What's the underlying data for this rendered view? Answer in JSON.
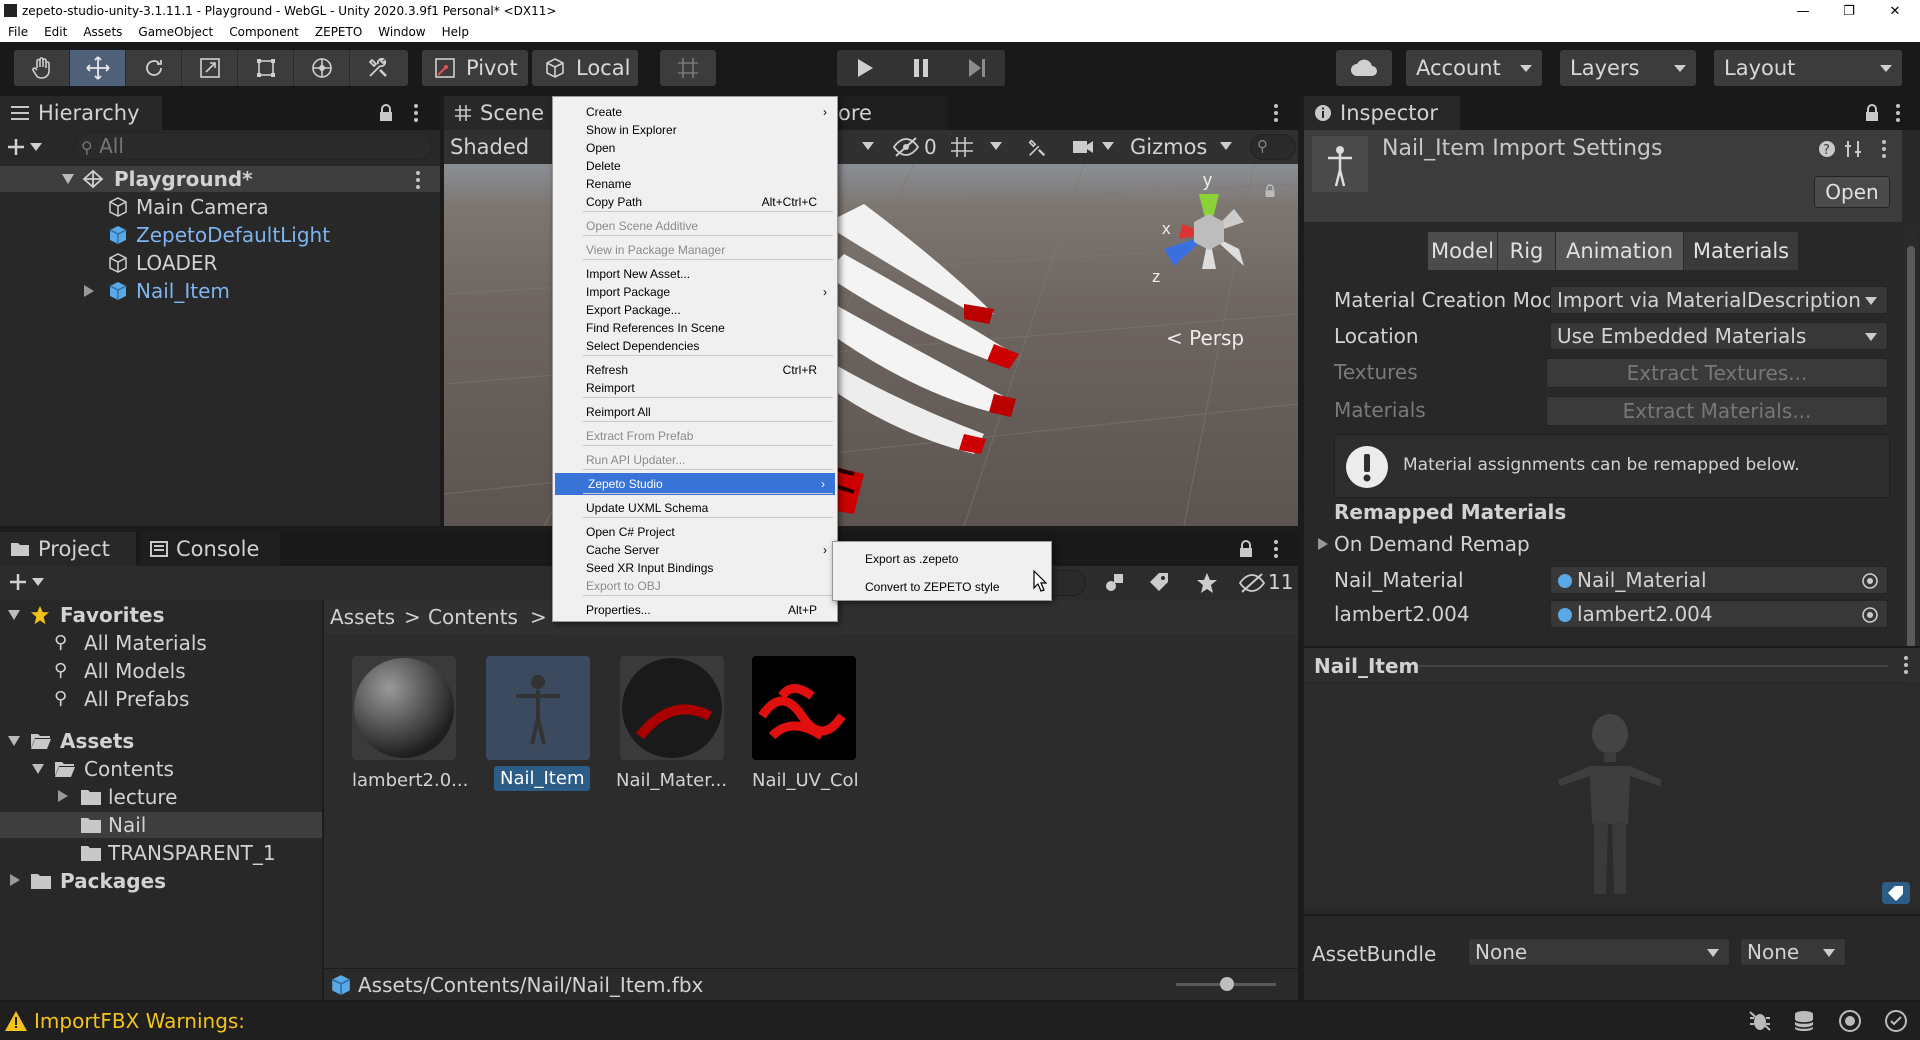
{
  "window": {
    "title": "zepeto-studio-unity-3.1.11.1 - Playground - WebGL - Unity 2020.3.9f1 Personal* <DX11>",
    "controls": [
      "—",
      "❐",
      "✕"
    ]
  },
  "menubar": [
    "File",
    "Edit",
    "Assets",
    "GameObject",
    "Component",
    "ZEPETO",
    "Window",
    "Help"
  ],
  "toolbar": {
    "pivot": "Pivot",
    "local": "Local",
    "account": "Account",
    "layers": "Layers",
    "layout": "Layout"
  },
  "hierarchy": {
    "tab": "Hierarchy",
    "search_placeholder": "All",
    "scene": "Playground*",
    "items": [
      "Main Camera",
      "ZepetoDefaultLight",
      "LOADER",
      "Nail_Item"
    ]
  },
  "scene": {
    "tab": "Scene",
    "tab2_partial": "ore",
    "shading": "Shaded",
    "hidden_count": "0",
    "gizmos": "Gizmos",
    "persp": "< Persp",
    "axes": {
      "y": "y",
      "x": "x",
      "z": "z"
    }
  },
  "context_menu": [
    {
      "label": "Create",
      "sub": true
    },
    {
      "label": "Show in Explorer"
    },
    {
      "label": "Open"
    },
    {
      "label": "Delete"
    },
    {
      "label": "Rename"
    },
    {
      "label": "Copy Path",
      "shortcut": "Alt+Ctrl+C"
    },
    {
      "label": "Open Scene Additive",
      "disabled": true
    },
    {
      "label": "View in Package Manager",
      "disabled": true
    },
    {
      "label": "Import New Asset..."
    },
    {
      "label": "Import Package",
      "sub": true
    },
    {
      "label": "Export Package..."
    },
    {
      "label": "Find References In Scene"
    },
    {
      "label": "Select Dependencies"
    },
    {
      "label": "Refresh",
      "shortcut": "Ctrl+R"
    },
    {
      "label": "Reimport"
    },
    {
      "label": "Reimport All"
    },
    {
      "label": "Extract From Prefab",
      "disabled": true
    },
    {
      "label": "Run API Updater...",
      "disabled": true
    },
    {
      "label": "Zepeto Studio",
      "sub": true,
      "highlighted": true
    },
    {
      "label": "Update UXML Schema"
    },
    {
      "label": "Open C# Project"
    },
    {
      "label": "Cache Server",
      "sub": true
    },
    {
      "label": "Seed XR Input Bindings"
    },
    {
      "label": "Export to OBJ",
      "disabled": true
    },
    {
      "label": "Properties...",
      "shortcut": "Alt+P"
    }
  ],
  "submenu": [
    "Export as .zepeto",
    "Convert to ZEPETO style"
  ],
  "project": {
    "tab": "Project",
    "tab_console": "Console",
    "hidden_count": "11",
    "favorites": "Favorites",
    "fav_items": [
      "All Materials",
      "All Models",
      "All Prefabs"
    ],
    "assets": "Assets",
    "contents": "Contents",
    "folders": [
      "lecture",
      "Nail",
      "TRANSPARENT_1"
    ],
    "packages": "Packages",
    "breadcrumb": [
      "Assets",
      ">",
      "Contents",
      ">"
    ],
    "files": [
      "lambert2.0...",
      "Nail_Item",
      "Nail_Mater...",
      "Nail_UV_Col"
    ],
    "path": "Assets/Contents/Nail/Nail_Item.fbx"
  },
  "inspector": {
    "tab": "Inspector",
    "title": "Nail_Item Import Settings",
    "open": "Open",
    "tabs": [
      "Model",
      "Rig",
      "Animation",
      "Materials"
    ],
    "material_creation_label": "Material Creation Moc",
    "material_creation_value": "Import via MaterialDescription",
    "location_label": "Location",
    "location_value": "Use Embedded Materials",
    "textures_label": "Textures",
    "extract_textures": "Extract Textures...",
    "materials_label": "Materials",
    "extract_materials": "Extract Materials...",
    "info": "Material assignments can be remapped below.",
    "remapped": "Remapped Materials",
    "on_demand": "On Demand Remap",
    "remaps": [
      {
        "name": "Nail_Material",
        "value": "Nail_Material"
      },
      {
        "name": "lambert2.004",
        "value": "lambert2.004"
      }
    ],
    "preview_title": "Nail_Item",
    "assetbundle_label": "AssetBundle",
    "assetbundle_value": "None",
    "assetbundle_variant": "None"
  },
  "statusbar": {
    "message": "ImportFBX Warnings:"
  },
  "colors": {
    "selection": "#2c5d87",
    "menu_highlight": "#3874d8",
    "link_blue": "#7eb4f0",
    "warning": "#f4c21b"
  }
}
